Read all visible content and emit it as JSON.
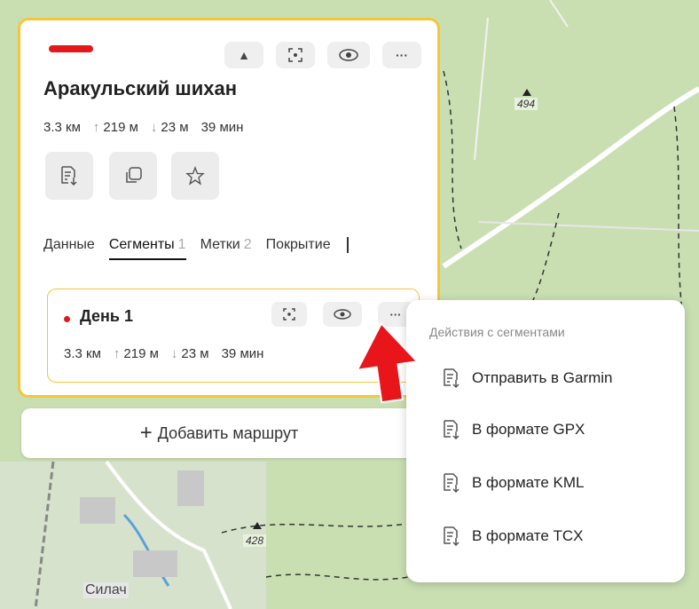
{
  "colors": {
    "accent": "#f5c53a",
    "route": "#e4181b",
    "arrow": "#e8161b"
  },
  "map": {
    "peak_labels": [
      "494",
      "428"
    ],
    "town": "Силач"
  },
  "panel": {
    "title": "Аракульский шихан",
    "toolbar_icons": [
      "triangle-up-icon",
      "focus-icon",
      "eye-icon",
      "more-icon"
    ],
    "toolbar_more": "···",
    "stats": {
      "distance": "3.3 км",
      "ascent": "219 м",
      "descent": "23 м",
      "time": "39 мин"
    },
    "actions": [
      "export-icon",
      "duplicate-icon",
      "star-icon"
    ],
    "tabs": [
      {
        "label": "Данные",
        "count": ""
      },
      {
        "label": "Сегменты",
        "count": "1"
      },
      {
        "label": "Метки",
        "count": "2"
      },
      {
        "label": "Покрытие",
        "count": ""
      }
    ],
    "active_tab": "Сегменты"
  },
  "segment": {
    "name": "День 1",
    "more": "···",
    "stats": {
      "distance": "3.3 км",
      "ascent": "219 м",
      "descent": "23 м",
      "time": "39 мин"
    }
  },
  "add_route": {
    "label": "Добавить маршрут"
  },
  "menu": {
    "header": "Действия с сегментами",
    "items": [
      "Отправить в Garmin",
      "В формате GPX",
      "В формате KML",
      "В формате TCX"
    ]
  }
}
